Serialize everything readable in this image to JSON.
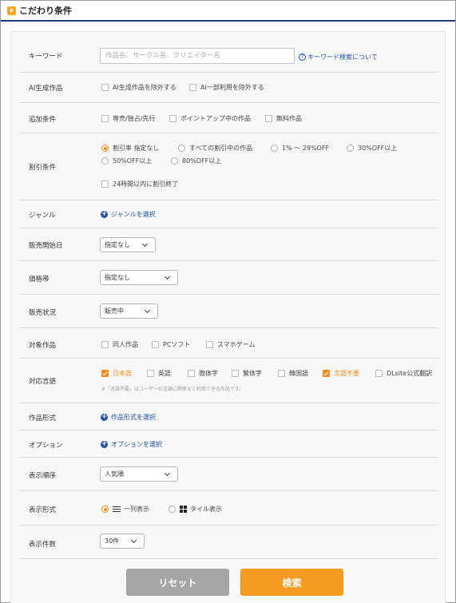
{
  "header": {
    "title": "こだわり条件"
  },
  "keyword": {
    "label": "キーワード",
    "placeholder": "作品名、サークル名、クリエイター名",
    "help_link": "キーワード検索について"
  },
  "ai": {
    "label": "AI生成作品",
    "options": [
      "AI生成作品を除外する",
      "AI一部利用を除外する"
    ]
  },
  "additional": {
    "label": "追加条件",
    "options": [
      "専売/独占/先行",
      "ポイントアップ中の作品",
      "無料作品"
    ]
  },
  "discount": {
    "label": "割引条件",
    "radios": [
      "割引率 指定なし",
      "すべての割引中の作品",
      "1% ～ 29%OFF",
      "30%OFF以上",
      "50%OFF以上",
      "80%OFF以上"
    ],
    "checkbox": "24時間以内に割引終了"
  },
  "genre": {
    "label": "ジャンル",
    "link": "ジャンルを選択"
  },
  "sale_start": {
    "label": "販売開始日",
    "value": "指定なし"
  },
  "price": {
    "label": "価格帯",
    "value": "指定なし"
  },
  "sale_status": {
    "label": "販売状況",
    "value": "販売中"
  },
  "target": {
    "label": "対象作品",
    "options": [
      "同人作品",
      "PCソフト",
      "スマホゲーム"
    ]
  },
  "language": {
    "label": "対応言語",
    "options": [
      "日本語",
      "英語",
      "簡体字",
      "繁体字",
      "韓国語",
      "言語不要",
      "DLsite公式翻訳"
    ],
    "note": "※「言語不要」はユーザーの言語に関係なく利用できる作品です。"
  },
  "format": {
    "label": "作品形式",
    "link": "作品形式を選択"
  },
  "option": {
    "label": "オプション",
    "link": "オプションを選択"
  },
  "order": {
    "label": "表示順序",
    "value": "人気順"
  },
  "display": {
    "label": "表示形式",
    "list": "一列表示",
    "tile": "タイル表示"
  },
  "count": {
    "label": "表示件数",
    "value": "30件"
  },
  "buttons": {
    "reset": "リセット",
    "search": "検索"
  },
  "colors": {
    "accent": "#f08c1a",
    "link": "#1f4ea0",
    "header_rule": "#1f3a6e",
    "reset": "#a5a5a5",
    "search": "#f79a22"
  },
  "icons": [
    "play-icon",
    "question-icon",
    "plus-circle-icon",
    "chevron-down-icon",
    "list-icon",
    "tile-icon"
  ]
}
